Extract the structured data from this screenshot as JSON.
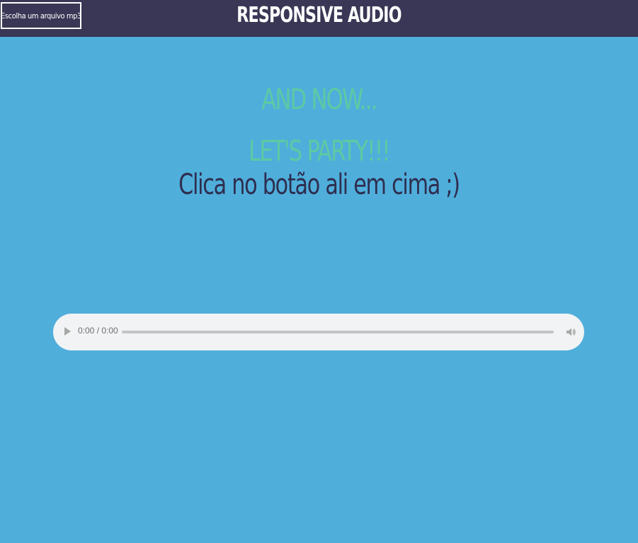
{
  "header": {
    "file_button_label": "Escolha um arquivo mp3",
    "title": "RESPONSIVE AUDIO"
  },
  "main": {
    "hero_line_1": "AND NOW...",
    "hero_line_2": "LET'S PARTY!!!",
    "hint": "Clica no botão ali em cima ;)"
  },
  "player": {
    "time_display": "0:00 / 0:00",
    "progress": 0
  },
  "icons": {
    "play": "play-icon",
    "volume": "volume-icon"
  },
  "colors": {
    "background": "#50aedb",
    "header_bg": "#393755",
    "hero_text": "#5ec9a3",
    "hint_text": "#2e2e4f"
  }
}
